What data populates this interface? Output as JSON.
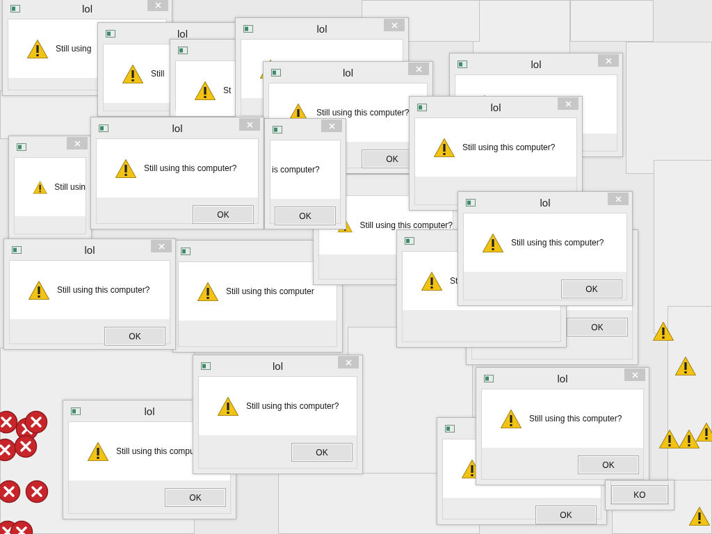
{
  "windows": [
    {
      "title": "lol",
      "message": "Still using"
    },
    {
      "title": "lol",
      "message": "Still"
    },
    {
      "message": "St"
    },
    {
      "title": "lol"
    },
    {
      "title": "lol"
    },
    {
      "button": "OK"
    },
    {
      "message": "Still using this computer"
    },
    {
      "message": "Still using this computer?"
    },
    {
      "message": "St"
    },
    {
      "title": "lol",
      "message": "Still using this computer?",
      "button": "OK"
    },
    {
      "title": "lol",
      "message": "Still using this computer?"
    },
    {
      "title": "lol",
      "message": "Still using this computer?",
      "button": "OK"
    },
    {
      "message": "Still usin"
    },
    {
      "title": "lol",
      "message": "Still using this computer?",
      "button": "OK"
    },
    {
      "message": "is computer?",
      "button": "OK"
    },
    {
      "title": "lol",
      "message": "Still using this computer?",
      "button": "OK"
    },
    {
      "title": "lol",
      "message": "Still using this compu",
      "button": "OK"
    },
    {
      "button": "OK"
    },
    {
      "title": "lol",
      "message": "Still using this computer?",
      "button": "OK"
    },
    {
      "title": "lol",
      "message": "Still using this computer?",
      "button": "OK"
    },
    {
      "button": "KO"
    }
  ]
}
